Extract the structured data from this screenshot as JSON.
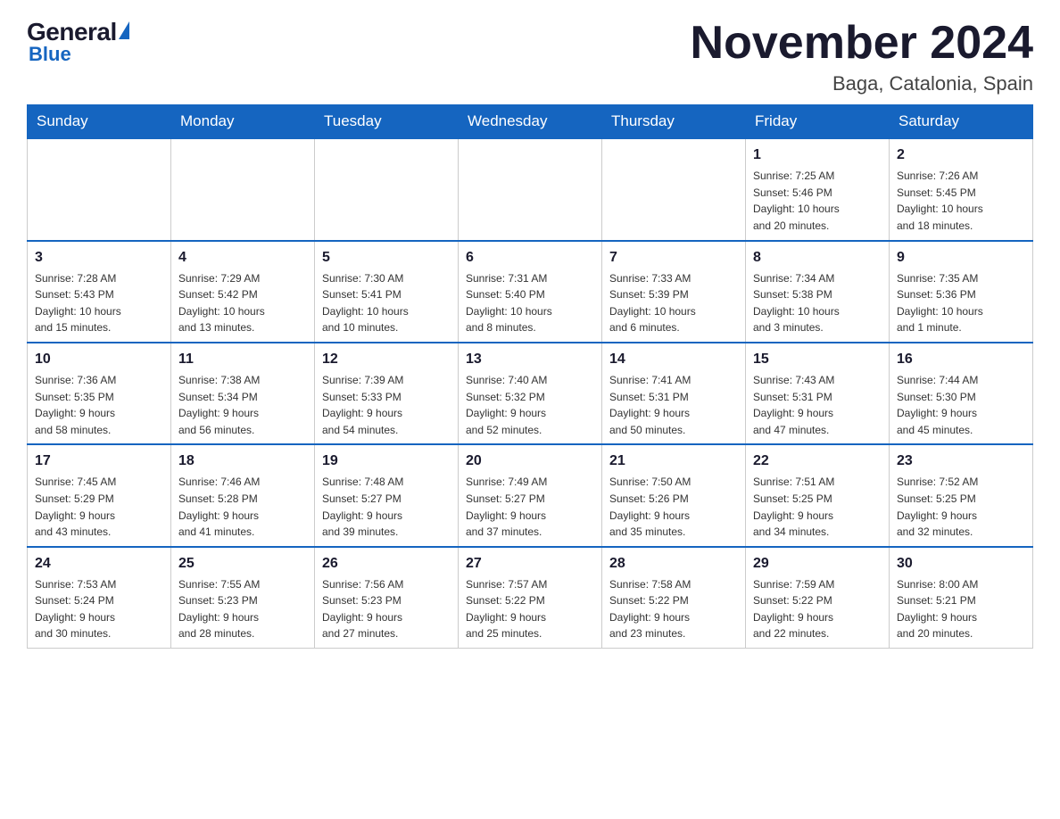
{
  "header": {
    "title": "November 2024",
    "subtitle": "Baga, Catalonia, Spain",
    "logo_general": "General",
    "logo_blue": "Blue"
  },
  "weekdays": [
    "Sunday",
    "Monday",
    "Tuesday",
    "Wednesday",
    "Thursday",
    "Friday",
    "Saturday"
  ],
  "weeks": [
    [
      {
        "day": "",
        "info": ""
      },
      {
        "day": "",
        "info": ""
      },
      {
        "day": "",
        "info": ""
      },
      {
        "day": "",
        "info": ""
      },
      {
        "day": "",
        "info": ""
      },
      {
        "day": "1",
        "info": "Sunrise: 7:25 AM\nSunset: 5:46 PM\nDaylight: 10 hours\nand 20 minutes."
      },
      {
        "day": "2",
        "info": "Sunrise: 7:26 AM\nSunset: 5:45 PM\nDaylight: 10 hours\nand 18 minutes."
      }
    ],
    [
      {
        "day": "3",
        "info": "Sunrise: 7:28 AM\nSunset: 5:43 PM\nDaylight: 10 hours\nand 15 minutes."
      },
      {
        "day": "4",
        "info": "Sunrise: 7:29 AM\nSunset: 5:42 PM\nDaylight: 10 hours\nand 13 minutes."
      },
      {
        "day": "5",
        "info": "Sunrise: 7:30 AM\nSunset: 5:41 PM\nDaylight: 10 hours\nand 10 minutes."
      },
      {
        "day": "6",
        "info": "Sunrise: 7:31 AM\nSunset: 5:40 PM\nDaylight: 10 hours\nand 8 minutes."
      },
      {
        "day": "7",
        "info": "Sunrise: 7:33 AM\nSunset: 5:39 PM\nDaylight: 10 hours\nand 6 minutes."
      },
      {
        "day": "8",
        "info": "Sunrise: 7:34 AM\nSunset: 5:38 PM\nDaylight: 10 hours\nand 3 minutes."
      },
      {
        "day": "9",
        "info": "Sunrise: 7:35 AM\nSunset: 5:36 PM\nDaylight: 10 hours\nand 1 minute."
      }
    ],
    [
      {
        "day": "10",
        "info": "Sunrise: 7:36 AM\nSunset: 5:35 PM\nDaylight: 9 hours\nand 58 minutes."
      },
      {
        "day": "11",
        "info": "Sunrise: 7:38 AM\nSunset: 5:34 PM\nDaylight: 9 hours\nand 56 minutes."
      },
      {
        "day": "12",
        "info": "Sunrise: 7:39 AM\nSunset: 5:33 PM\nDaylight: 9 hours\nand 54 minutes."
      },
      {
        "day": "13",
        "info": "Sunrise: 7:40 AM\nSunset: 5:32 PM\nDaylight: 9 hours\nand 52 minutes."
      },
      {
        "day": "14",
        "info": "Sunrise: 7:41 AM\nSunset: 5:31 PM\nDaylight: 9 hours\nand 50 minutes."
      },
      {
        "day": "15",
        "info": "Sunrise: 7:43 AM\nSunset: 5:31 PM\nDaylight: 9 hours\nand 47 minutes."
      },
      {
        "day": "16",
        "info": "Sunrise: 7:44 AM\nSunset: 5:30 PM\nDaylight: 9 hours\nand 45 minutes."
      }
    ],
    [
      {
        "day": "17",
        "info": "Sunrise: 7:45 AM\nSunset: 5:29 PM\nDaylight: 9 hours\nand 43 minutes."
      },
      {
        "day": "18",
        "info": "Sunrise: 7:46 AM\nSunset: 5:28 PM\nDaylight: 9 hours\nand 41 minutes."
      },
      {
        "day": "19",
        "info": "Sunrise: 7:48 AM\nSunset: 5:27 PM\nDaylight: 9 hours\nand 39 minutes."
      },
      {
        "day": "20",
        "info": "Sunrise: 7:49 AM\nSunset: 5:27 PM\nDaylight: 9 hours\nand 37 minutes."
      },
      {
        "day": "21",
        "info": "Sunrise: 7:50 AM\nSunset: 5:26 PM\nDaylight: 9 hours\nand 35 minutes."
      },
      {
        "day": "22",
        "info": "Sunrise: 7:51 AM\nSunset: 5:25 PM\nDaylight: 9 hours\nand 34 minutes."
      },
      {
        "day": "23",
        "info": "Sunrise: 7:52 AM\nSunset: 5:25 PM\nDaylight: 9 hours\nand 32 minutes."
      }
    ],
    [
      {
        "day": "24",
        "info": "Sunrise: 7:53 AM\nSunset: 5:24 PM\nDaylight: 9 hours\nand 30 minutes."
      },
      {
        "day": "25",
        "info": "Sunrise: 7:55 AM\nSunset: 5:23 PM\nDaylight: 9 hours\nand 28 minutes."
      },
      {
        "day": "26",
        "info": "Sunrise: 7:56 AM\nSunset: 5:23 PM\nDaylight: 9 hours\nand 27 minutes."
      },
      {
        "day": "27",
        "info": "Sunrise: 7:57 AM\nSunset: 5:22 PM\nDaylight: 9 hours\nand 25 minutes."
      },
      {
        "day": "28",
        "info": "Sunrise: 7:58 AM\nSunset: 5:22 PM\nDaylight: 9 hours\nand 23 minutes."
      },
      {
        "day": "29",
        "info": "Sunrise: 7:59 AM\nSunset: 5:22 PM\nDaylight: 9 hours\nand 22 minutes."
      },
      {
        "day": "30",
        "info": "Sunrise: 8:00 AM\nSunset: 5:21 PM\nDaylight: 9 hours\nand 20 minutes."
      }
    ]
  ]
}
